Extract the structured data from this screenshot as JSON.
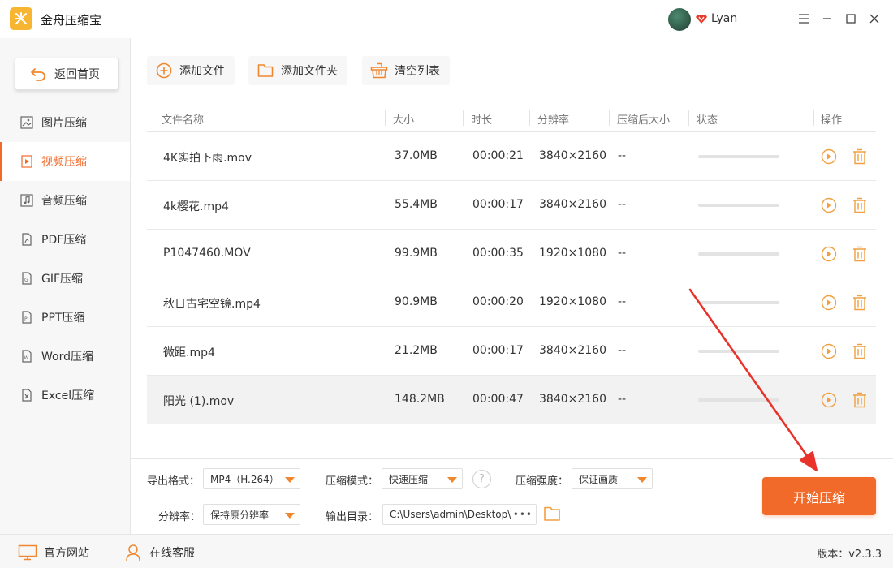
{
  "app": {
    "title": "金舟压缩宝",
    "user_name": "Lyan"
  },
  "sidebar": {
    "back_label": "返回首页",
    "items": [
      {
        "label": "图片压缩",
        "icon": "image-icon"
      },
      {
        "label": "视频压缩",
        "icon": "video-icon",
        "active": true
      },
      {
        "label": "音频压缩",
        "icon": "music-icon"
      },
      {
        "label": "PDF压缩",
        "icon": "pdf-icon"
      },
      {
        "label": "GIF压缩",
        "icon": "gif-icon"
      },
      {
        "label": "PPT压缩",
        "icon": "ppt-icon"
      },
      {
        "label": "Word压缩",
        "icon": "word-icon"
      },
      {
        "label": "Excel压缩",
        "icon": "excel-icon"
      }
    ]
  },
  "toolbar": {
    "add_file": "添加文件",
    "add_folder": "添加文件夹",
    "clear_list": "清空列表"
  },
  "table": {
    "columns": [
      "文件名称",
      "大小",
      "时长",
      "分辨率",
      "压缩后大小",
      "状态",
      "操作"
    ],
    "rows": [
      {
        "name": "4K实拍下雨.mov",
        "size": "37.0MB",
        "duration": "00:00:21",
        "resolution": "3840×2160",
        "compressed": "--"
      },
      {
        "name": "4k樱花.mp4",
        "size": "55.4MB",
        "duration": "00:00:17",
        "resolution": "3840×2160",
        "compressed": "--"
      },
      {
        "name": "P1047460.MOV",
        "size": "99.9MB",
        "duration": "00:00:35",
        "resolution": "1920×1080",
        "compressed": "--"
      },
      {
        "name": "秋日古宅空镜.mp4",
        "size": "90.9MB",
        "duration": "00:00:20",
        "resolution": "1920×1080",
        "compressed": "--"
      },
      {
        "name": "微距.mp4",
        "size": "21.2MB",
        "duration": "00:00:17",
        "resolution": "3840×2160",
        "compressed": "--"
      },
      {
        "name": "阳光 (1).mov",
        "size": "148.2MB",
        "duration": "00:00:47",
        "resolution": "3840×2160",
        "compressed": "--",
        "selected": true
      }
    ]
  },
  "settings": {
    "format_label": "导出格式：",
    "format_value": "MP4（H.264）",
    "mode_label": "压缩模式：",
    "mode_value": "快速压缩",
    "strength_label": "压缩强度：",
    "strength_value": "保证画质",
    "resolution_label": "分辨率：",
    "resolution_value": "保持原分辨率",
    "output_label": "输出目录：",
    "output_value": "C:\\Users\\admin\\Desktop\\",
    "help_symbol": "?",
    "start_label": "开始压缩"
  },
  "footer": {
    "website": "官方网站",
    "support": "在线客服",
    "version": "版本：v2.3.3"
  },
  "colors": {
    "accent": "#f26a2a",
    "icon_orange": "#f0a040",
    "annotation_red": "#e8322a"
  }
}
